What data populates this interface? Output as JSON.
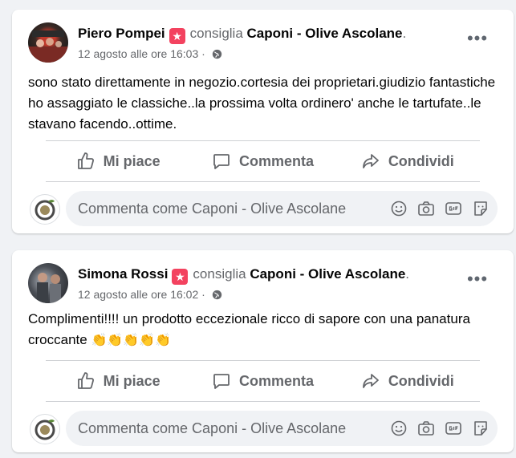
{
  "posts": [
    {
      "author": "Piero Pompei",
      "badge_icon": "star",
      "verb": "consiglia",
      "page": "Caponi - Olive Ascolane",
      "period": ".",
      "timestamp": "12 agosto alle ore 16:03",
      "separator": "·",
      "more": "•••",
      "text": "sono stato direttamente in negozio.cortesia dei proprietari.giudizio fantastiche ho assaggiato le classiche..la prossima volta ordinero' anche le tartufate..le stavano facendo..ottime.",
      "actions": {
        "like": "Mi piace",
        "comment": "Commenta",
        "share": "Condividi"
      },
      "comment_placeholder": "Commenta come Caponi - Olive Ascolane"
    },
    {
      "author": "Simona Rossi",
      "badge_icon": "star",
      "verb": "consiglia",
      "page": "Caponi - Olive Ascolane",
      "period": ".",
      "timestamp": "12 agosto alle ore 16:02",
      "separator": "·",
      "more": "•••",
      "text": "Complimenti!!!! un prodotto eccezionale ricco di sapore con una panatura croccante",
      "emoji": "👏👏👏👏👏",
      "actions": {
        "like": "Mi piace",
        "comment": "Commenta",
        "share": "Condividi"
      },
      "comment_placeholder": "Commenta come Caponi - Olive Ascolane"
    }
  ],
  "colors": {
    "badge": "#f3425f",
    "secondary_text": "#65676b",
    "background": "#f0f2f5"
  }
}
